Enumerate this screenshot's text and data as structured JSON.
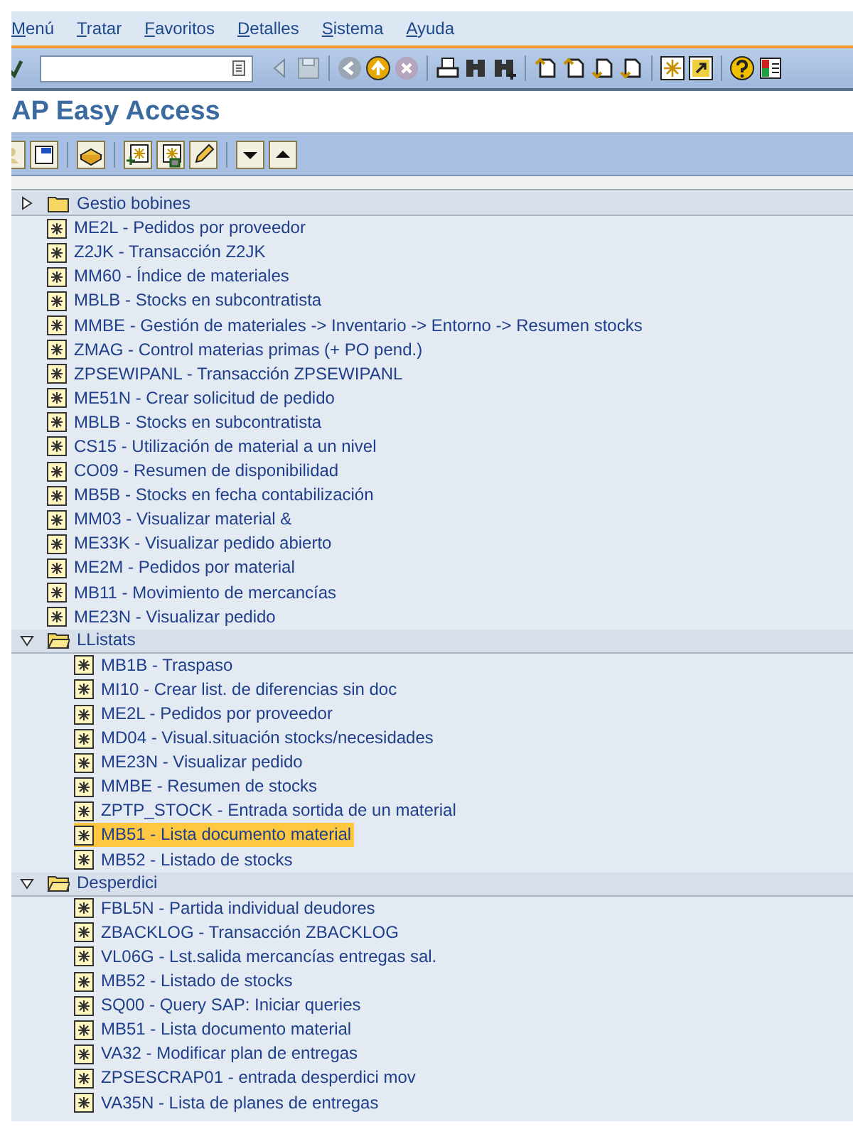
{
  "menu_bar": [
    "Menú",
    "Tratar",
    "Favoritos",
    "Detalles",
    "Sistema",
    "Ayuda"
  ],
  "title": "AP Easy Access",
  "tree": [
    {
      "kind": "folder",
      "label": "Gestio bobines",
      "expanded": false,
      "selected": false
    },
    {
      "kind": "transaction",
      "label": "ME2L - Pedidos por proveedor",
      "selected": false
    },
    {
      "kind": "transaction",
      "label": "Z2JK - Transacción Z2JK",
      "selected": false
    },
    {
      "kind": "transaction",
      "label": "MM60 - Índice de materiales",
      "selected": false
    },
    {
      "kind": "transaction",
      "label": "MBLB - Stocks en subcontratista",
      "selected": false
    },
    {
      "kind": "transaction",
      "label": "MMBE - Gestión de materiales -> Inventario -> Entorno -> Resumen stocks",
      "selected": false
    },
    {
      "kind": "transaction",
      "label": "ZMAG - Control materias primas (+ PO pend.)",
      "selected": false
    },
    {
      "kind": "transaction",
      "label": "ZPSEWIPANL - Transacción ZPSEWIPANL",
      "selected": false
    },
    {
      "kind": "transaction",
      "label": "ME51N - Crear solicitud de pedido",
      "selected": false
    },
    {
      "kind": "transaction",
      "label": "MBLB - Stocks en subcontratista",
      "selected": false
    },
    {
      "kind": "transaction",
      "label": "CS15 - Utilización de material a un nivel",
      "selected": false
    },
    {
      "kind": "transaction",
      "label": "CO09 - Resumen de disponibilidad",
      "selected": false
    },
    {
      "kind": "transaction",
      "label": "MB5B - Stocks en fecha contabilización",
      "selected": false
    },
    {
      "kind": "transaction",
      "label": "MM03 - Visualizar material &",
      "selected": false
    },
    {
      "kind": "transaction",
      "label": "ME33K - Visualizar pedido abierto",
      "selected": false
    },
    {
      "kind": "transaction",
      "label": "ME2M - Pedidos por material",
      "selected": false
    },
    {
      "kind": "transaction",
      "label": "MB11 - Movimiento de mercancías",
      "selected": false
    },
    {
      "kind": "transaction",
      "label": "ME23N - Visualizar pedido",
      "selected": false
    },
    {
      "kind": "folder",
      "label": "LListats",
      "expanded": true,
      "selected": false,
      "children": [
        {
          "kind": "transaction",
          "label": "MB1B - Traspaso",
          "selected": false
        },
        {
          "kind": "transaction",
          "label": "MI10 - Crear list. de diferencias sin doc",
          "selected": false
        },
        {
          "kind": "transaction",
          "label": "ME2L - Pedidos por proveedor",
          "selected": false
        },
        {
          "kind": "transaction",
          "label": "MD04 - Visual.situación stocks/necesidades",
          "selected": false
        },
        {
          "kind": "transaction",
          "label": "ME23N - Visualizar pedido",
          "selected": false
        },
        {
          "kind": "transaction",
          "label": "MMBE - Resumen de stocks",
          "selected": false
        },
        {
          "kind": "transaction",
          "label": "ZPTP_STOCK - Entrada sortida de un material",
          "selected": false
        },
        {
          "kind": "transaction",
          "label": "MB51 - Lista documento material",
          "selected": true
        },
        {
          "kind": "transaction",
          "label": "MB52 - Listado de stocks",
          "selected": false
        }
      ]
    },
    {
      "kind": "folder",
      "label": "Desperdici",
      "expanded": true,
      "selected": false,
      "children": [
        {
          "kind": "transaction",
          "label": "FBL5N - Partida individual deudores",
          "selected": false
        },
        {
          "kind": "transaction",
          "label": "ZBACKLOG - Transacción ZBACKLOG",
          "selected": false
        },
        {
          "kind": "transaction",
          "label": "VL06G - Lst.salida mercancías entregas sal.",
          "selected": false
        },
        {
          "kind": "transaction",
          "label": "MB52 - Listado de stocks",
          "selected": false
        },
        {
          "kind": "transaction",
          "label": "SQ00 - Query SAP: Iniciar queries",
          "selected": false
        },
        {
          "kind": "transaction",
          "label": "MB51 - Lista documento material",
          "selected": false
        },
        {
          "kind": "transaction",
          "label": "VA32 - Modificar plan de entregas",
          "selected": false
        },
        {
          "kind": "transaction",
          "label": "ZPSESCRAP01 - entrada desperdici mov",
          "selected": false
        },
        {
          "kind": "transaction",
          "label": "VA35N - Lista de planes de entregas",
          "selected": false
        }
      ]
    }
  ]
}
